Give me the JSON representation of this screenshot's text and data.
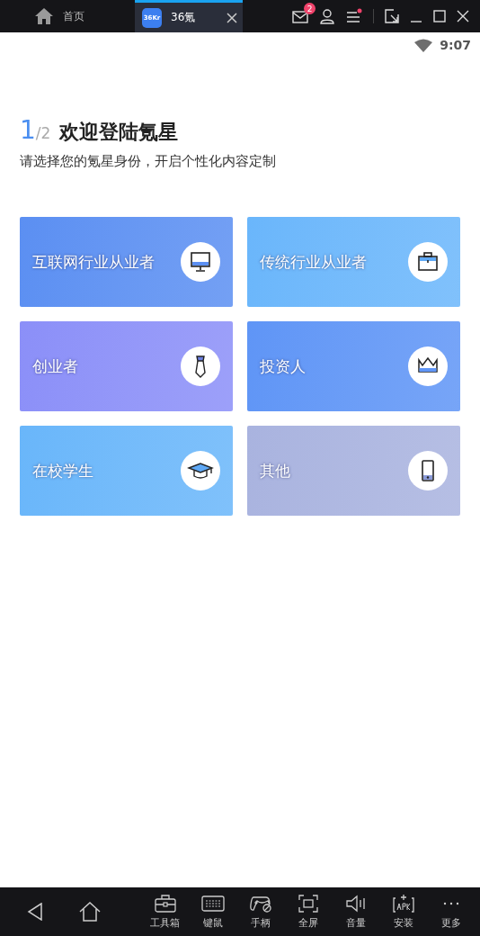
{
  "tabs": [
    {
      "kind": "home",
      "label": "首页",
      "selected": false
    },
    {
      "kind": "app",
      "label": "36氪",
      "app_icon": "36Kr",
      "selected": true
    }
  ],
  "mail_badge": "2",
  "status_bar": {
    "time": "9:07"
  },
  "header": {
    "step": "1",
    "total": "/2",
    "title": "欢迎登陆氪星",
    "subtitle": "请选择您的氪星身份，开启个性化内容定制"
  },
  "roles": [
    {
      "label": "互联网行业从业者",
      "kind": "monitor",
      "color": "#5b8ff2"
    },
    {
      "label": "传统行业从业者",
      "kind": "briefcase",
      "color": "#6ab6fb"
    },
    {
      "label": "创业者",
      "kind": "tie",
      "color": "#8b8ff8"
    },
    {
      "label": "投资人",
      "kind": "crown",
      "color": "#5f95f6"
    },
    {
      "label": "在校学生",
      "kind": "cap",
      "color": "#69b6fa"
    },
    {
      "label": "其他",
      "kind": "phone",
      "color": "#a9b3df"
    }
  ],
  "toolbar": [
    {
      "kind": "toolbox",
      "label": "工具箱"
    },
    {
      "kind": "keyboard",
      "label": "键鼠"
    },
    {
      "kind": "gamepad",
      "label": "手柄"
    },
    {
      "kind": "fullscreen",
      "label": "全屏"
    },
    {
      "kind": "volume",
      "label": "音量"
    },
    {
      "kind": "apk",
      "label": "安装"
    },
    {
      "kind": "more",
      "label": "更多"
    }
  ]
}
